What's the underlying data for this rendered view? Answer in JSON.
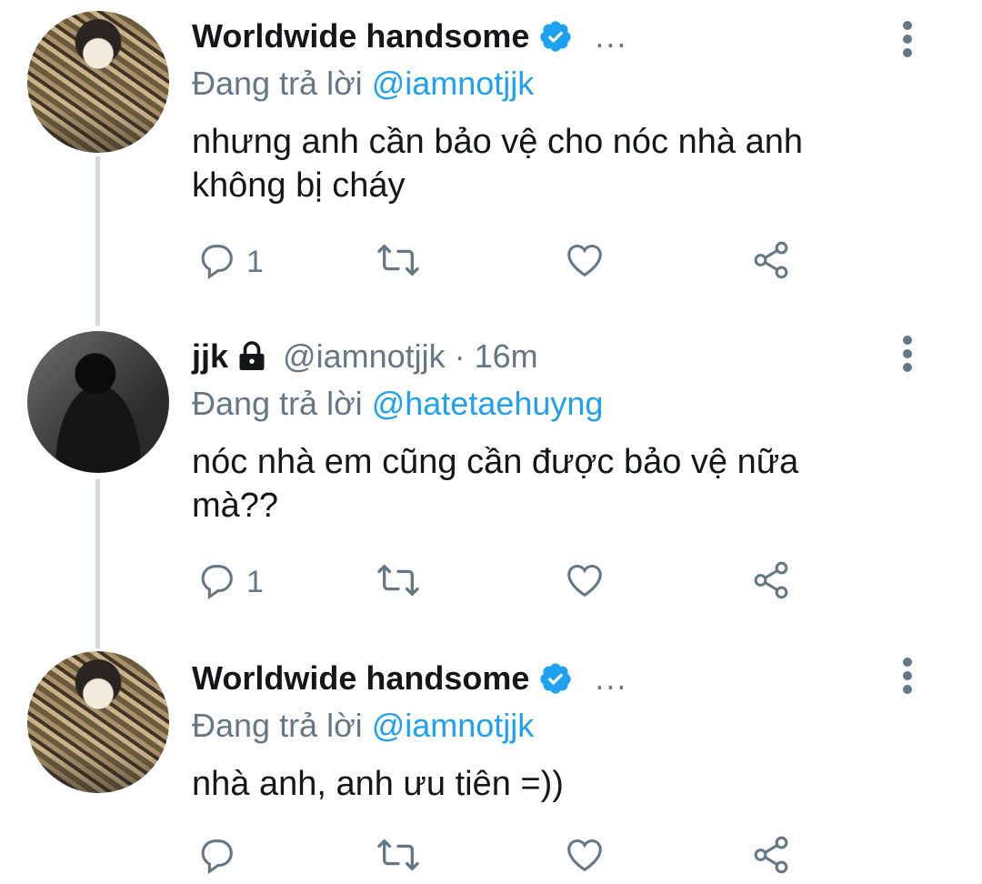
{
  "tweets": [
    {
      "author": "Worldwide handsome",
      "verified": true,
      "handle": "",
      "time": "",
      "show_ellipsis": true,
      "ellipsis": "...",
      "reply_prefix": "Đang trả lời",
      "reply_to": "@iamnotjjk",
      "text_line1": "nhưng anh cần bảo vệ cho nóc nhà anh",
      "text_line2": "không bị cháy",
      "reply_count": "1",
      "avatar": "fur-coat-avatar"
    },
    {
      "author": "jjk",
      "verified": false,
      "protected": true,
      "handle_meta": "@iamnotjjk · 16m",
      "reply_prefix": "Đang trả lời",
      "reply_to": "@hatetaehuyng",
      "text_line1": "nóc nhà em cũng cần được bảo vệ nữa",
      "text_line2": "mà??",
      "reply_count": "1",
      "avatar": "dark-hat-avatar"
    },
    {
      "author": "Worldwide handsome",
      "verified": true,
      "show_ellipsis": true,
      "ellipsis": "...",
      "reply_prefix": "Đang trả lời",
      "reply_to": "@iamnotjjk",
      "text_line1": "nhà anh, anh ưu tiên =))",
      "reply_count": "",
      "avatar": "fur-coat-avatar"
    }
  ],
  "colors": {
    "accent": "#1da1f2",
    "secondary": "#657786",
    "text": "#14171a",
    "thread_line": "#cfd9de"
  },
  "icons": [
    "verified-badge-icon",
    "lock-icon",
    "more-vertical-icon",
    "reply-icon",
    "retweet-icon",
    "like-icon",
    "share-icon"
  ]
}
